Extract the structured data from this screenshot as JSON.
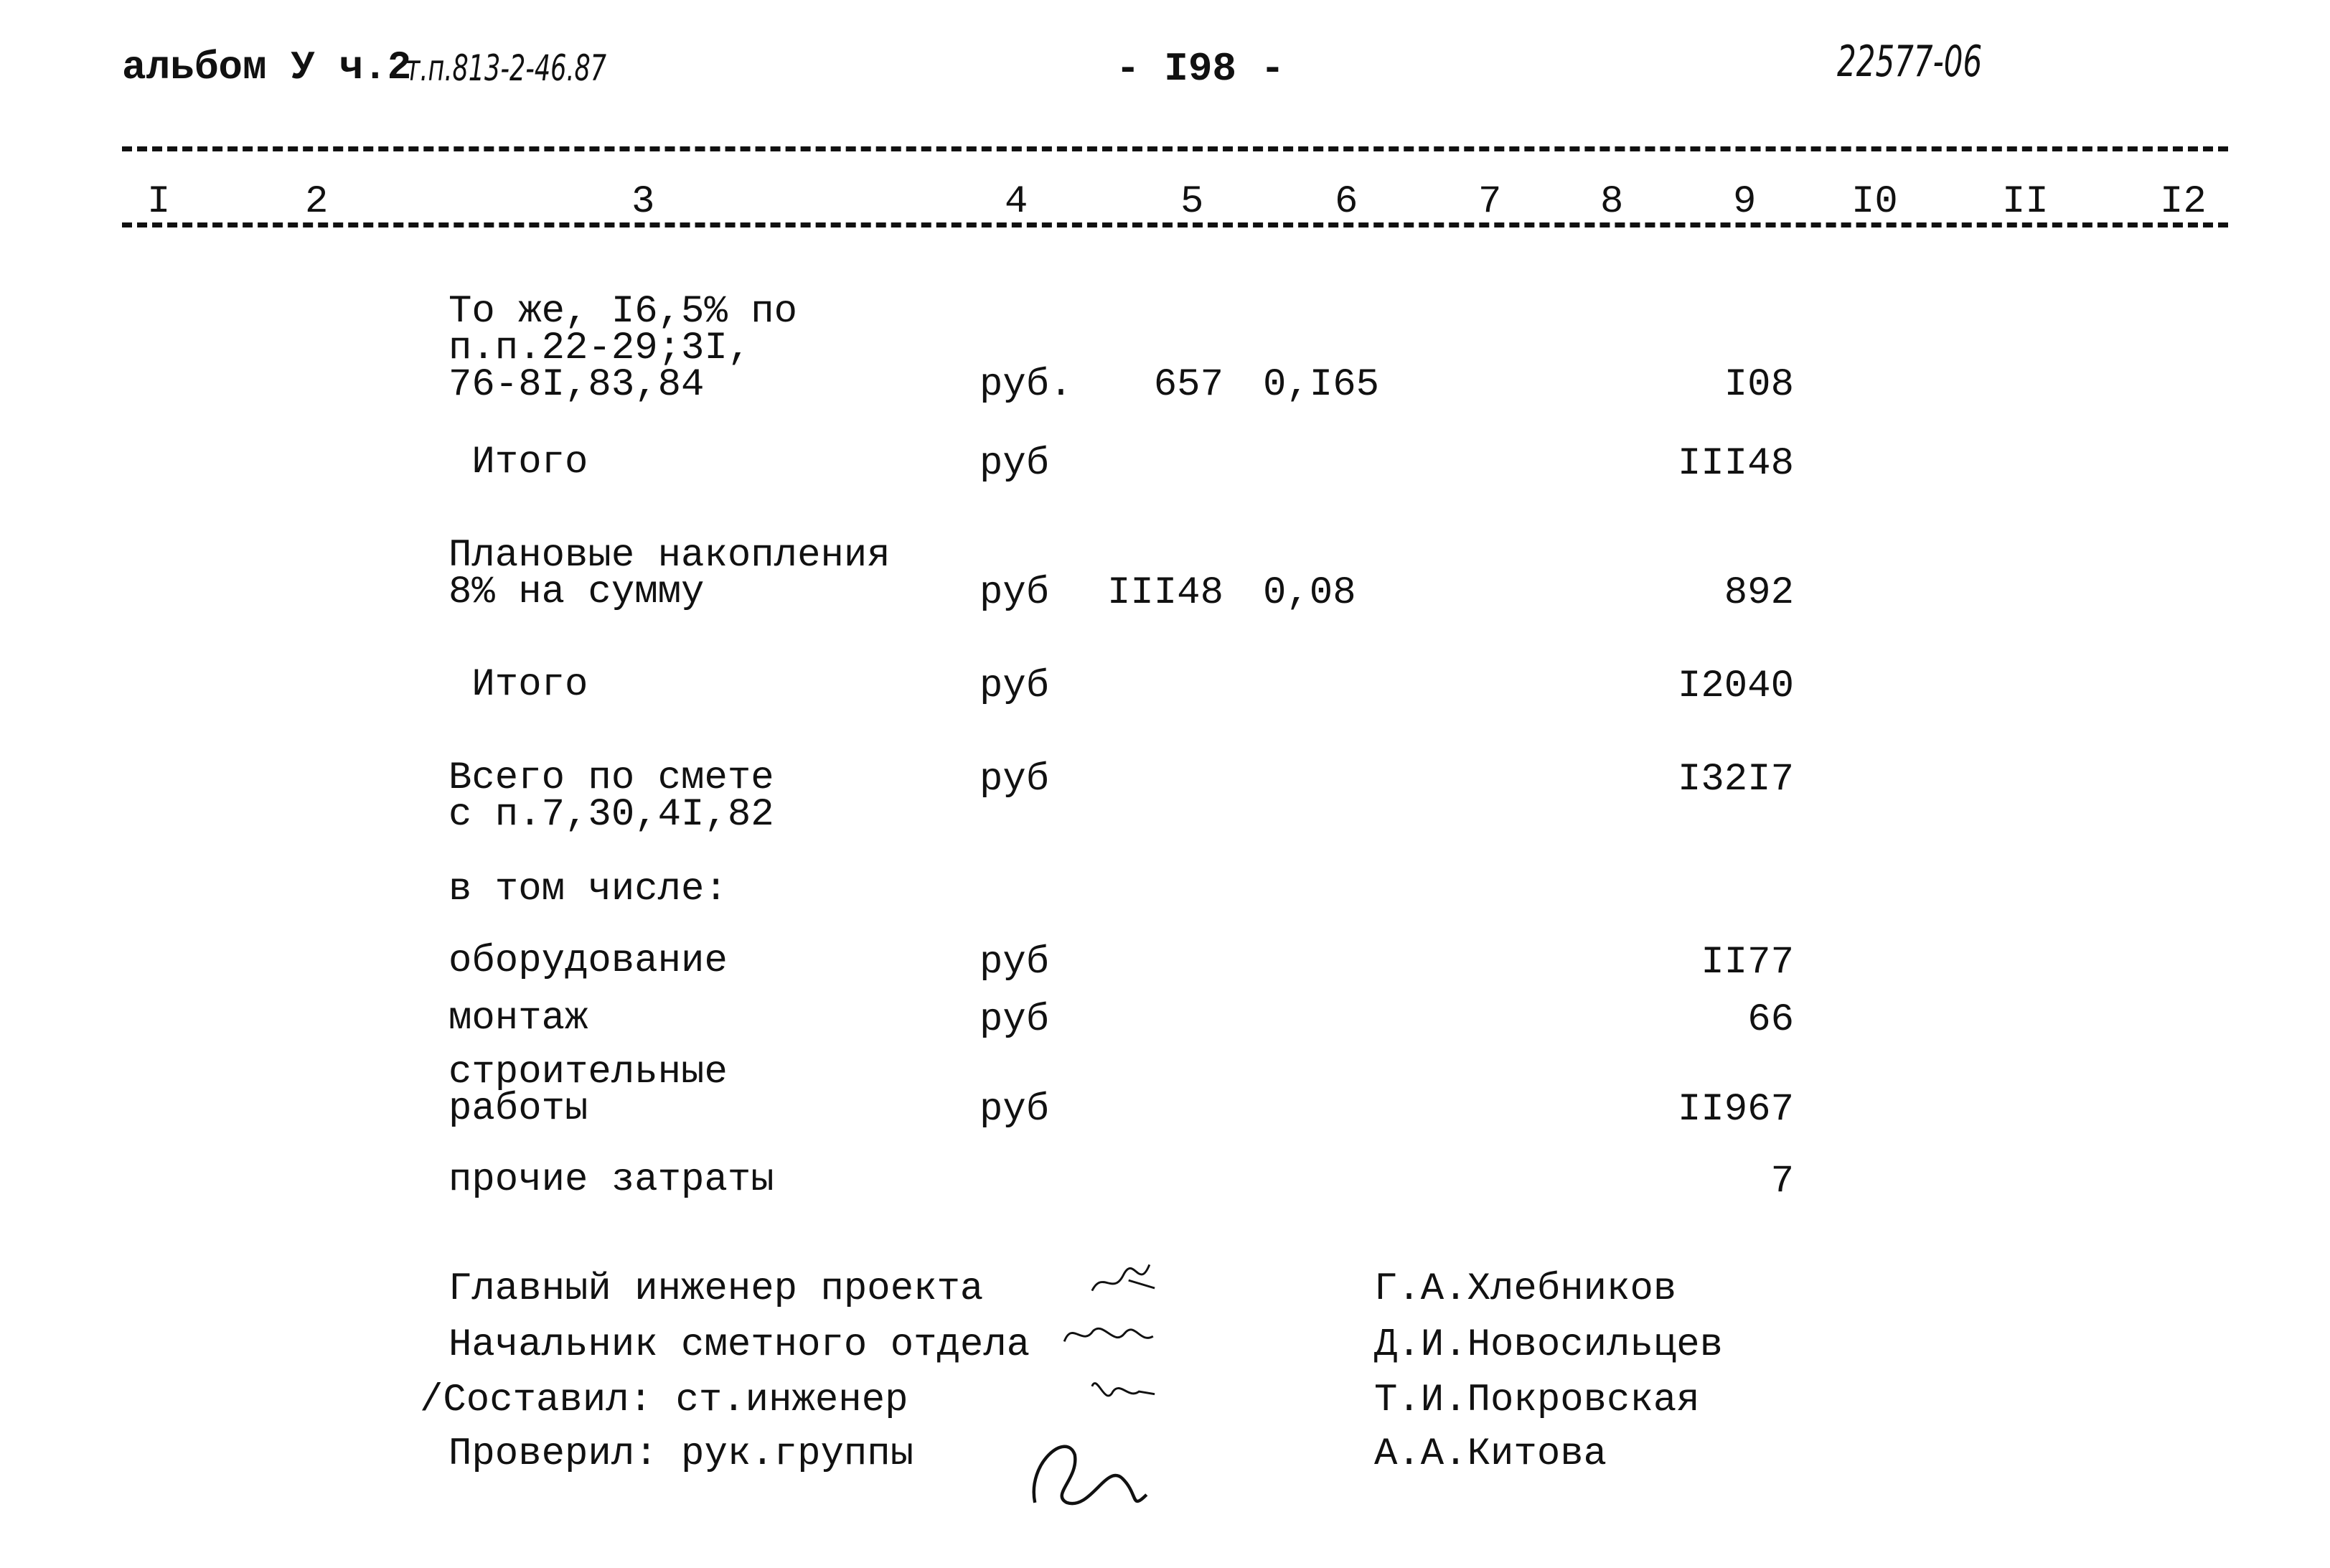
{
  "header": {
    "album": "альбом У ч.2",
    "project_code": "т.п.813-2-46.87",
    "page_number": "- I98 -",
    "doc_number": "22577-06"
  },
  "column_numbers": [
    "I",
    "2",
    "3",
    "4",
    "5",
    "6",
    "7",
    "8",
    "9",
    "I0",
    "II",
    "I2"
  ],
  "rows": [
    {
      "description": "То же, I6,5% по\nп.п.22-29;3I,\n76-8I,83,84",
      "unit": "руб.",
      "col5": "657",
      "col6": "0,I65",
      "col9": "I08"
    },
    {
      "description": " Итого",
      "unit": "руб",
      "col5": "",
      "col6": "",
      "col9": "III48"
    },
    {
      "description": "Плановые накопления\n8% на сумму",
      "unit": "руб",
      "col5": "III48",
      "col6": "0,08",
      "col9": "892"
    },
    {
      "description": " Итого",
      "unit": "руб",
      "col5": "",
      "col6": "",
      "col9": "I2040"
    },
    {
      "description": "Всего по смете\nс п.7,30,4I,82",
      "unit": "руб",
      "col5": "",
      "col6": "",
      "col9": "I32I7"
    },
    {
      "description": "в том числе:",
      "unit": "",
      "col5": "",
      "col6": "",
      "col9": ""
    },
    {
      "description": "оборудование",
      "unit": "руб",
      "col5": "",
      "col6": "",
      "col9": "II77"
    },
    {
      "description": "монтаж",
      "unit": "руб",
      "col5": "",
      "col6": "",
      "col9": "66"
    },
    {
      "description": "строительные\nработы",
      "unit": "руб",
      "col5": "",
      "col6": "",
      "col9": "II967"
    },
    {
      "description": "прочие затраты",
      "unit": "",
      "col5": "",
      "col6": "",
      "col9": "7"
    }
  ],
  "signatures": [
    {
      "role": "Главный инженер проекта",
      "signature": "signature-icon",
      "name": "Г.А.Хлебников"
    },
    {
      "role": "Начальник сметного отдела",
      "signature": "signature-icon",
      "name": "Д.И.Новосильцев"
    },
    {
      "role": "/Составил: ст.инженер",
      "signature": "signature-icon",
      "name": "Т.И.Покровская"
    },
    {
      "role": "Проверил: рук.группы",
      "signature": "signature-icon",
      "name": "А.А.Китова"
    }
  ]
}
